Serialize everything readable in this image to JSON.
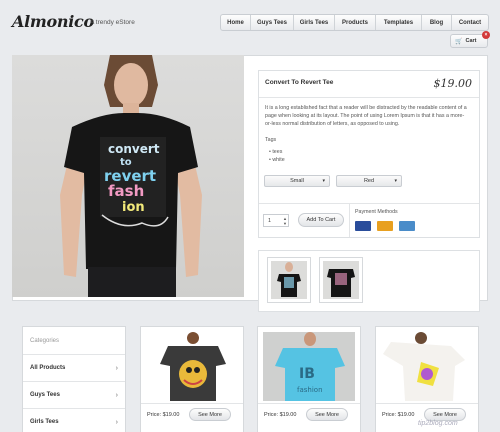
{
  "header": {
    "logo": "Almonico",
    "tagline": "A trendy eStore",
    "nav": [
      "Home",
      "Guys Tees",
      "Girls Tees",
      "Products",
      "Templates",
      "Blog",
      "Contact"
    ],
    "cart_label": "Cart"
  },
  "product": {
    "title": "Convert To Revert Tee",
    "price": "$19.00",
    "description": "It is a long established fact that a reader will be distracted by the readable content of a page when looking at its layout. The point of using Lorem Ipsum is that it has a more-or-less normal distribution of letters, as opposed to using.",
    "tags_label": "Tags",
    "tags": [
      "tees",
      "white"
    ],
    "size_selected": "Small",
    "color_selected": "Red",
    "quantity": "1",
    "add_to_cart": "Add To Cart",
    "payment_label": "Payment Methods",
    "cards": [
      {
        "icon": "visa-card-icon",
        "color": "#2a4d9b"
      },
      {
        "icon": "mastercard-icon",
        "color": "#e8a020"
      },
      {
        "icon": "amex-card-icon",
        "color": "#4a8cc9"
      }
    ]
  },
  "categories": {
    "heading": "Categories",
    "items": [
      "All Products",
      "Guys Tees",
      "Girls Tees"
    ]
  },
  "products": [
    {
      "price": "Price: $19.00",
      "button": "See More"
    },
    {
      "price": "Price: $19.00",
      "button": "See More"
    },
    {
      "price": "Price: $19.00",
      "button": "See More"
    }
  ],
  "watermark": "tip2blog.com"
}
